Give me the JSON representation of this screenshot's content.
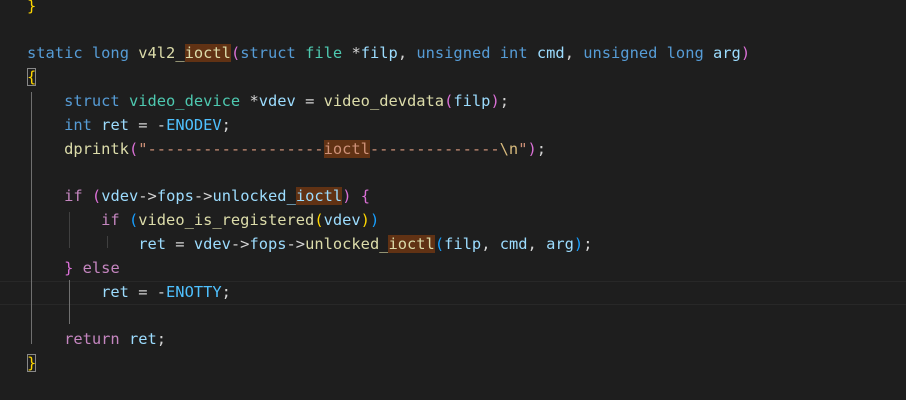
{
  "editor": {
    "language": "c",
    "lines": [
      {
        "id": "l0",
        "tokens": [
          {
            "t": "}",
            "c": "gold"
          }
        ]
      },
      {
        "id": "l1",
        "tokens": []
      },
      {
        "id": "l2",
        "tokens": [
          {
            "t": "static",
            "c": "kw"
          },
          {
            "t": " ",
            "c": "plain"
          },
          {
            "t": "long",
            "c": "kw"
          },
          {
            "t": " ",
            "c": "plain"
          },
          {
            "t": "v4l2_",
            "c": "fn"
          },
          {
            "t": "ioctl",
            "c": "fn",
            "hl": true
          },
          {
            "t": "(",
            "c": "pink"
          },
          {
            "t": "struct",
            "c": "kw"
          },
          {
            "t": " ",
            "c": "plain"
          },
          {
            "t": "file",
            "c": "type"
          },
          {
            "t": " *",
            "c": "plain"
          },
          {
            "t": "filp",
            "c": "var"
          },
          {
            "t": ", ",
            "c": "plain"
          },
          {
            "t": "unsigned",
            "c": "kw"
          },
          {
            "t": " ",
            "c": "plain"
          },
          {
            "t": "int",
            "c": "kw"
          },
          {
            "t": " ",
            "c": "plain"
          },
          {
            "t": "cmd",
            "c": "var"
          },
          {
            "t": ", ",
            "c": "plain"
          },
          {
            "t": "unsigned",
            "c": "kw"
          },
          {
            "t": " ",
            "c": "plain"
          },
          {
            "t": "long",
            "c": "kw"
          },
          {
            "t": " ",
            "c": "plain"
          },
          {
            "t": "arg",
            "c": "var"
          },
          {
            "t": ")",
            "c": "pink"
          }
        ]
      },
      {
        "id": "l3",
        "tokens": [
          {
            "t": "{",
            "c": "gold",
            "box": true
          }
        ]
      },
      {
        "id": "l4",
        "tokens": [
          {
            "t": "    ",
            "c": "plain"
          },
          {
            "t": "struct",
            "c": "kw"
          },
          {
            "t": " ",
            "c": "plain"
          },
          {
            "t": "video_device",
            "c": "type"
          },
          {
            "t": " *",
            "c": "plain"
          },
          {
            "t": "vdev",
            "c": "var"
          },
          {
            "t": " = ",
            "c": "plain"
          },
          {
            "t": "video_devdata",
            "c": "fn"
          },
          {
            "t": "(",
            "c": "pink"
          },
          {
            "t": "filp",
            "c": "var"
          },
          {
            "t": ")",
            "c": "pink"
          },
          {
            "t": ";",
            "c": "plain"
          }
        ]
      },
      {
        "id": "l5",
        "tokens": [
          {
            "t": "    ",
            "c": "plain"
          },
          {
            "t": "int",
            "c": "kw"
          },
          {
            "t": " ",
            "c": "plain"
          },
          {
            "t": "ret",
            "c": "var"
          },
          {
            "t": " = -",
            "c": "plain"
          },
          {
            "t": "ENODEV",
            "c": "const"
          },
          {
            "t": ";",
            "c": "plain"
          }
        ]
      },
      {
        "id": "l6",
        "tokens": [
          {
            "t": "    ",
            "c": "plain"
          },
          {
            "t": "dprintk",
            "c": "fn"
          },
          {
            "t": "(",
            "c": "pink"
          },
          {
            "t": "\"-------------------",
            "c": "str"
          },
          {
            "t": "ioctl",
            "c": "str",
            "hl": true
          },
          {
            "t": "--------------",
            "c": "str"
          },
          {
            "t": "\\n",
            "c": "esc"
          },
          {
            "t": "\"",
            "c": "str"
          },
          {
            "t": ")",
            "c": "pink"
          },
          {
            "t": ";",
            "c": "plain"
          }
        ]
      },
      {
        "id": "l7",
        "tokens": []
      },
      {
        "id": "l8",
        "tokens": [
          {
            "t": "    ",
            "c": "plain"
          },
          {
            "t": "if",
            "c": "ctrl"
          },
          {
            "t": " ",
            "c": "plain"
          },
          {
            "t": "(",
            "c": "pink"
          },
          {
            "t": "vdev",
            "c": "var"
          },
          {
            "t": "->",
            "c": "plain"
          },
          {
            "t": "fops",
            "c": "var"
          },
          {
            "t": "->",
            "c": "plain"
          },
          {
            "t": "unlocked_",
            "c": "var"
          },
          {
            "t": "ioctl",
            "c": "var",
            "hl": true
          },
          {
            "t": ")",
            "c": "pink"
          },
          {
            "t": " ",
            "c": "plain"
          },
          {
            "t": "{",
            "c": "pink"
          }
        ]
      },
      {
        "id": "l9",
        "tokens": [
          {
            "t": "        ",
            "c": "plain"
          },
          {
            "t": "if",
            "c": "ctrl"
          },
          {
            "t": " ",
            "c": "plain"
          },
          {
            "t": "(",
            "c": "blue"
          },
          {
            "t": "video_is_registered",
            "c": "fn"
          },
          {
            "t": "(",
            "c": "gold"
          },
          {
            "t": "vdev",
            "c": "var"
          },
          {
            "t": ")",
            "c": "gold"
          },
          {
            "t": ")",
            "c": "blue"
          }
        ]
      },
      {
        "id": "l10",
        "tokens": [
          {
            "t": "            ",
            "c": "plain"
          },
          {
            "t": "ret",
            "c": "var"
          },
          {
            "t": " = ",
            "c": "plain"
          },
          {
            "t": "vdev",
            "c": "var"
          },
          {
            "t": "->",
            "c": "plain"
          },
          {
            "t": "fops",
            "c": "var"
          },
          {
            "t": "->",
            "c": "plain"
          },
          {
            "t": "unlocked_",
            "c": "fn"
          },
          {
            "t": "ioctl",
            "c": "fn",
            "hl": true
          },
          {
            "t": "(",
            "c": "blue"
          },
          {
            "t": "filp",
            "c": "var"
          },
          {
            "t": ", ",
            "c": "plain"
          },
          {
            "t": "cmd",
            "c": "var"
          },
          {
            "t": ", ",
            "c": "plain"
          },
          {
            "t": "arg",
            "c": "var"
          },
          {
            "t": ")",
            "c": "blue"
          },
          {
            "t": ";",
            "c": "plain"
          }
        ]
      },
      {
        "id": "l11",
        "tokens": [
          {
            "t": "    ",
            "c": "plain"
          },
          {
            "t": "}",
            "c": "pink"
          },
          {
            "t": " ",
            "c": "plain"
          },
          {
            "t": "else",
            "c": "ctrl"
          }
        ]
      },
      {
        "id": "l12",
        "tokens": [
          {
            "t": "        ",
            "c": "plain"
          },
          {
            "t": "ret",
            "c": "var"
          },
          {
            "t": " = -",
            "c": "plain"
          },
          {
            "t": "ENOTTY",
            "c": "const"
          },
          {
            "t": ";",
            "c": "plain"
          }
        ]
      },
      {
        "id": "l13",
        "tokens": []
      },
      {
        "id": "l14",
        "tokens": [
          {
            "t": "    ",
            "c": "plain"
          },
          {
            "t": "return",
            "c": "ctrl"
          },
          {
            "t": " ",
            "c": "plain"
          },
          {
            "t": "ret",
            "c": "var"
          },
          {
            "t": ";",
            "c": "plain"
          }
        ]
      },
      {
        "id": "l15",
        "tokens": [
          {
            "t": "}",
            "c": "gold",
            "box": true
          }
        ]
      }
    ],
    "token_colors": {
      "kw": "#569cd6",
      "ctrl": "#c586c0",
      "type": "#4ec9b0",
      "fn": "#dcdcaa",
      "var": "#9cdcfe",
      "const": "#4fc1ff",
      "str": "#ce9178",
      "esc": "#d7ba7d",
      "plain": "#d4d4d4",
      "gold": "#ffd700",
      "pink": "#da70d6",
      "blue": "#179fff"
    },
    "highlight_color": "#613214",
    "background": "#1e1e1e"
  }
}
